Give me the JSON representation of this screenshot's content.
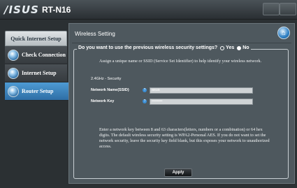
{
  "header": {
    "logo": "/ISUS",
    "model": "RT-N16"
  },
  "sidebar": {
    "title": "Quick Internet Setup",
    "items": [
      {
        "label": "Check Connection"
      },
      {
        "label": "Internet Setup"
      },
      {
        "label": "Router Setup"
      }
    ]
  },
  "main": {
    "title": "Wireless Setting",
    "question": "Do you want to use the previous wireless security settings?",
    "option_yes": "Yes",
    "option_no": "No",
    "intro": "Assign a unique name or SSID (Service Set Identifier) to help identify your wireless network.",
    "band": "2.4GHz - Security",
    "ssid_label": "Network Name(SSID)",
    "ssid_value": "asus",
    "key_label": "Network Key",
    "key_value": "••••••••",
    "help_glyph": "?",
    "note": "Enter a network key between 8 and 63 characters(letters, numbers or a combination) or 64 hex digits. The default wireless security setting is WPA2-Personal AES. If you do not want to set the network security, leave the security key field blank, but this exposes your network to unauthorized access.",
    "apply_label": "Apply"
  },
  "colors": {
    "active_item": "#3a7db5",
    "panel_bg": "#4e585e"
  }
}
